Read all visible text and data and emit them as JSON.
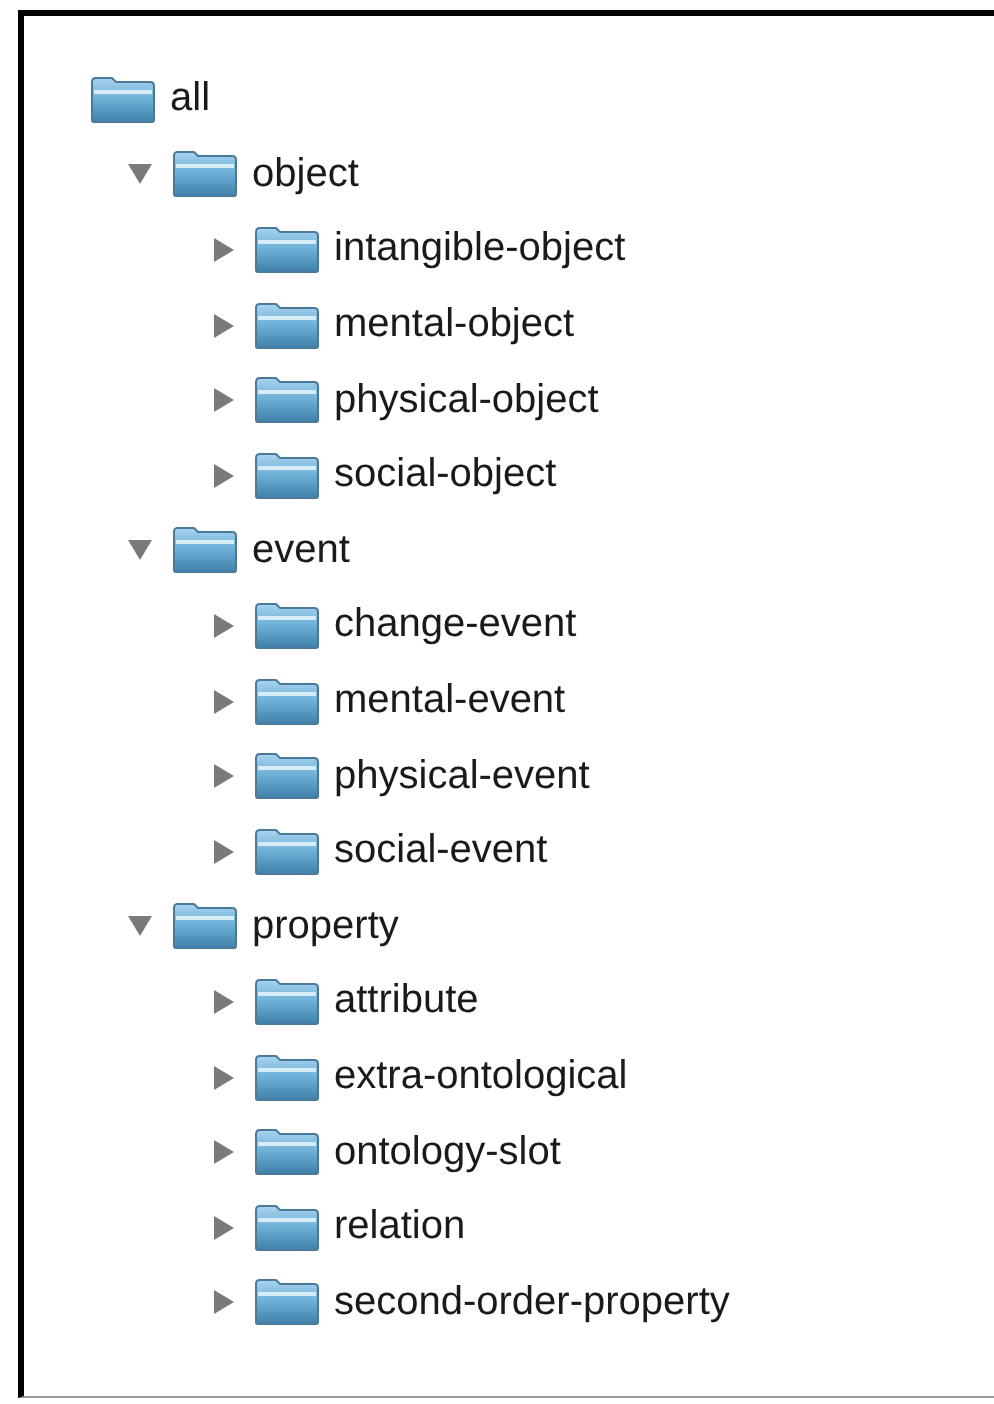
{
  "tree": {
    "root": {
      "label": "all",
      "children": [
        {
          "label": "object",
          "expanded": true,
          "children": [
            {
              "label": "intangible-object",
              "expanded": false
            },
            {
              "label": "mental-object",
              "expanded": false
            },
            {
              "label": "physical-object",
              "expanded": false
            },
            {
              "label": "social-object",
              "expanded": false
            }
          ]
        },
        {
          "label": "event",
          "expanded": true,
          "children": [
            {
              "label": "change-event",
              "expanded": false
            },
            {
              "label": "mental-event",
              "expanded": false
            },
            {
              "label": "physical-event",
              "expanded": false
            },
            {
              "label": "social-event",
              "expanded": false
            }
          ]
        },
        {
          "label": "property",
          "expanded": true,
          "children": [
            {
              "label": "attribute",
              "expanded": false
            },
            {
              "label": "extra-ontological",
              "expanded": false
            },
            {
              "label": "ontology-slot",
              "expanded": false
            },
            {
              "label": "relation",
              "expanded": false
            },
            {
              "label": "second-order-property",
              "expanded": false
            }
          ]
        }
      ]
    }
  }
}
